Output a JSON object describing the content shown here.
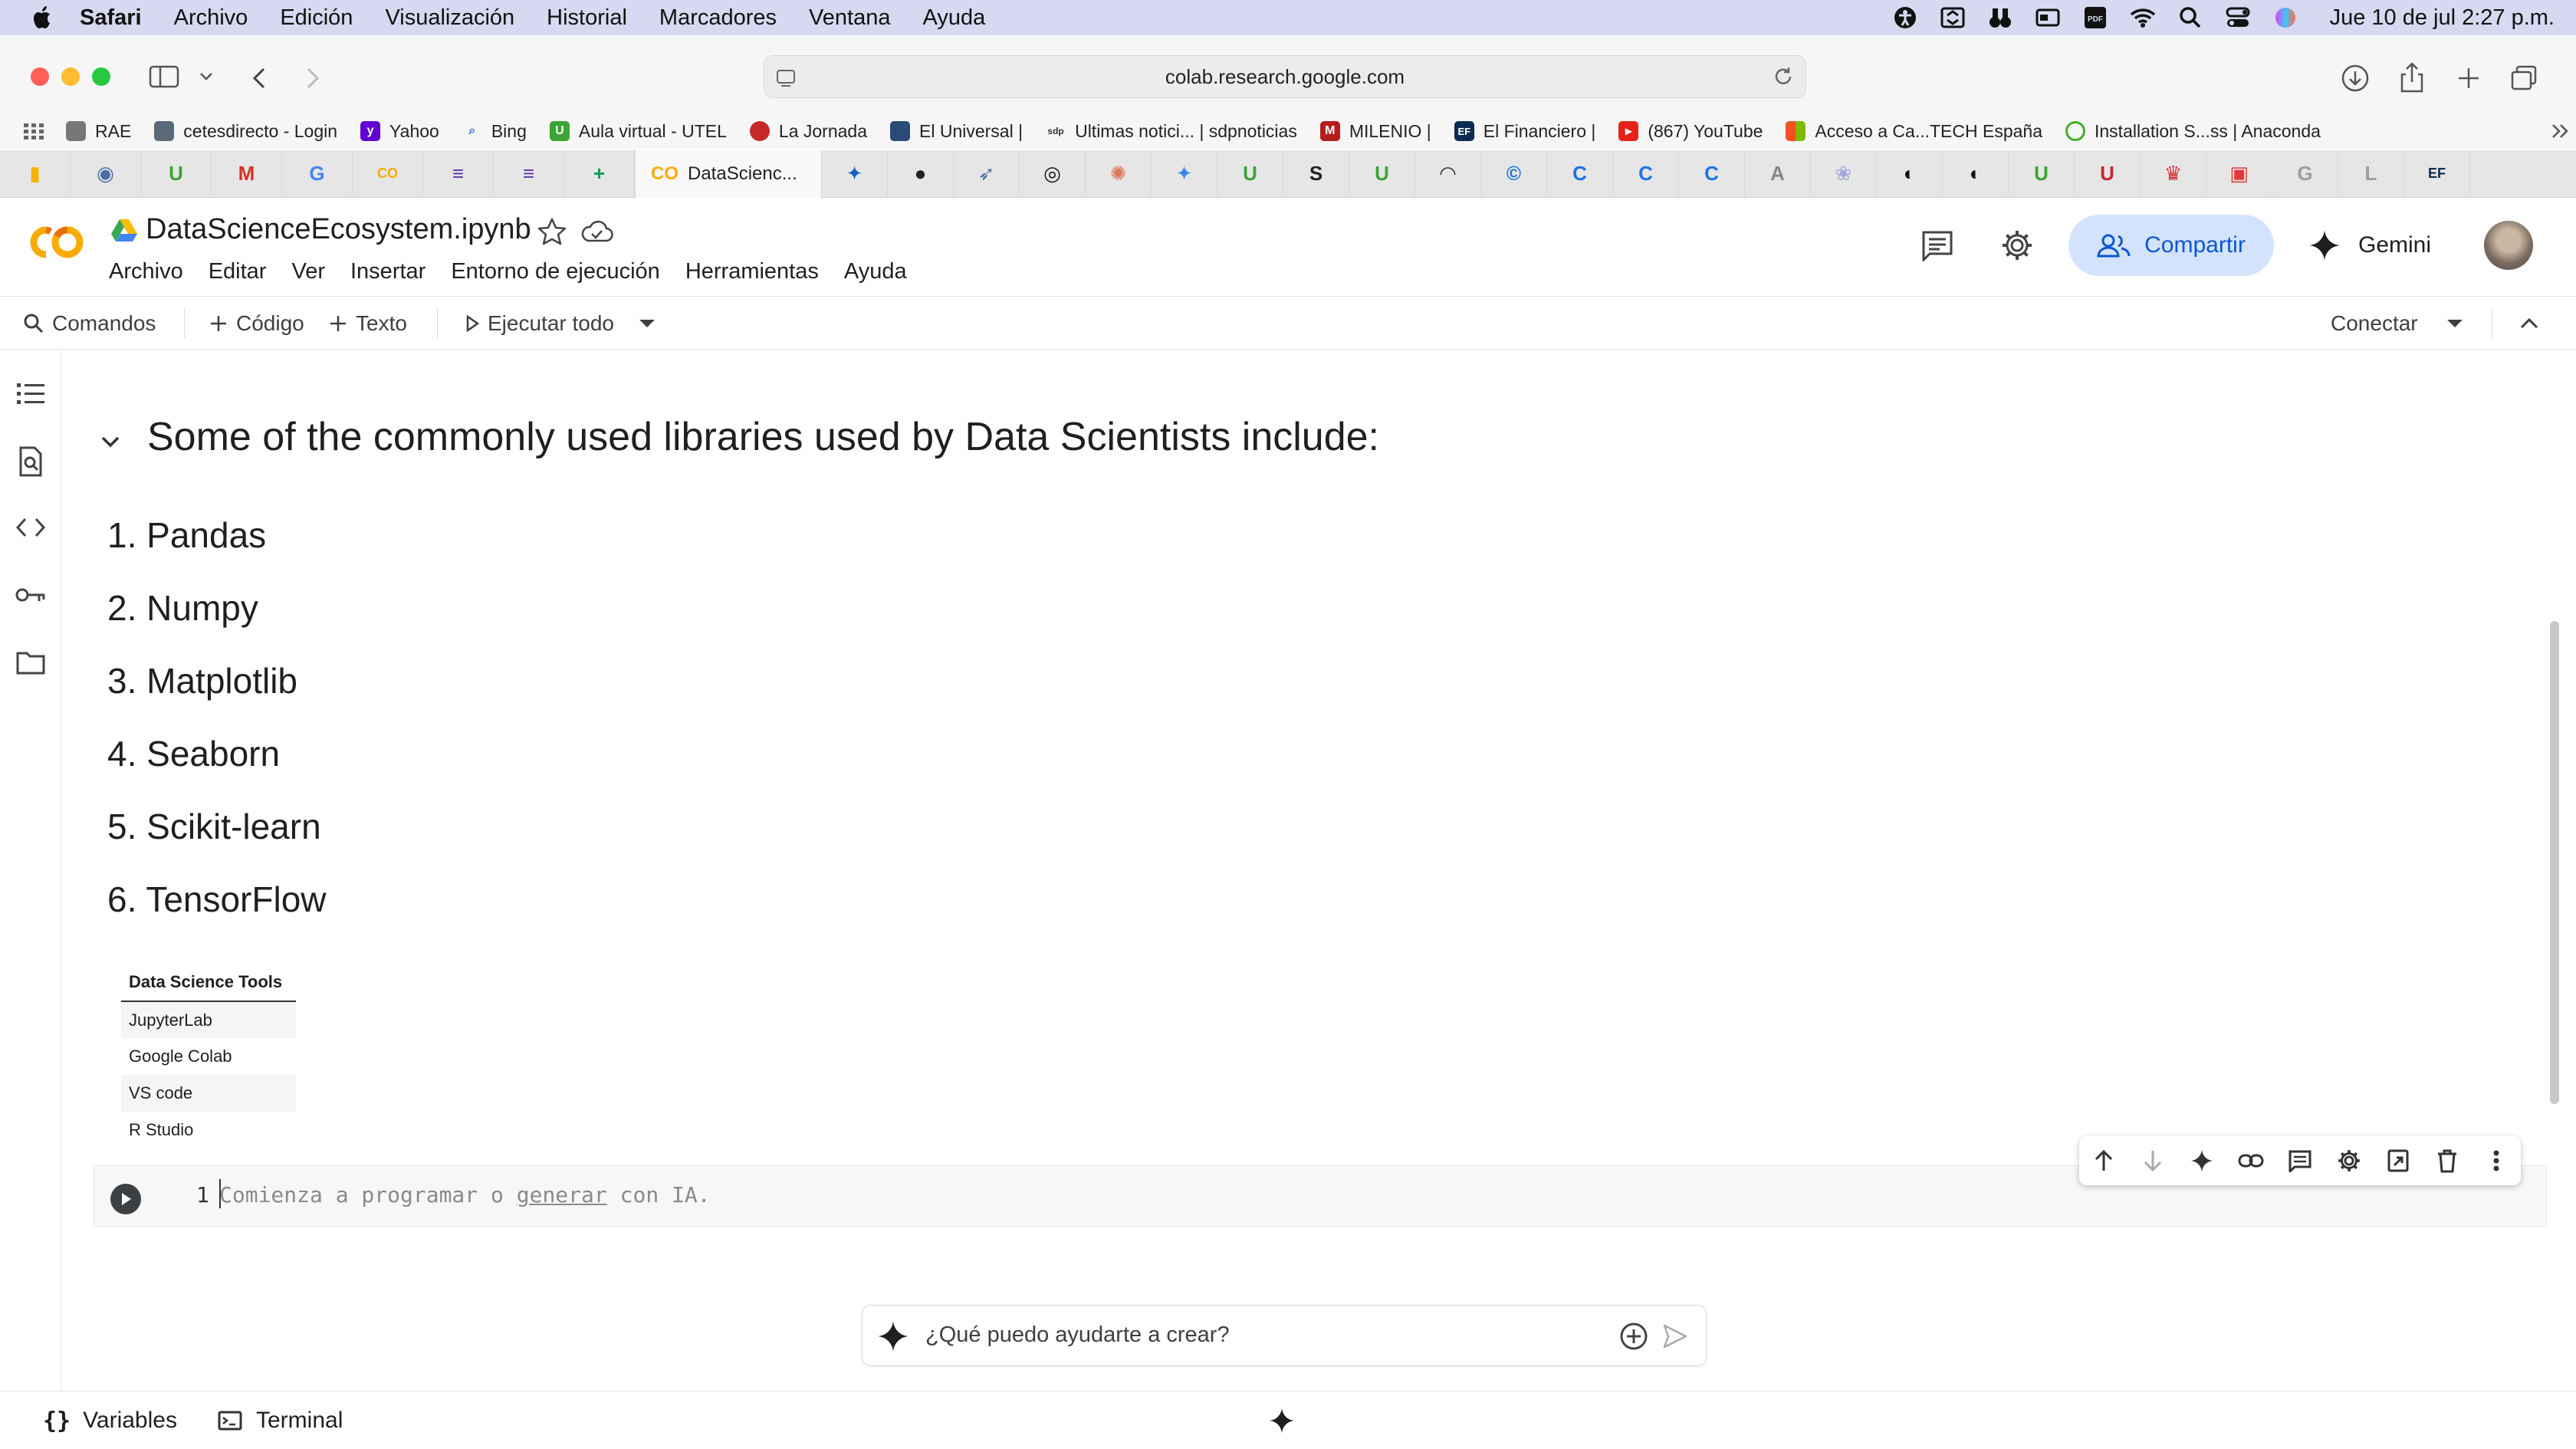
{
  "macos_menubar": {
    "app": "Safari",
    "items": [
      "Archivo",
      "Edición",
      "Visualización",
      "Historial",
      "Marcadores",
      "Ventana",
      "Ayuda"
    ],
    "clock": "Jue 10 de jul   2:27 p.m.",
    "status_icons": [
      "accessibility-icon",
      "sync-icon",
      "binoculars-icon",
      "card-icon",
      "pdf-icon",
      "wifi-icon",
      "search-icon",
      "control-center-icon",
      "siri-icon"
    ]
  },
  "safari": {
    "url": "colab.research.google.com",
    "bookmarks": [
      {
        "label": "RAE",
        "color": "#777"
      },
      {
        "label": "cetesdirecto - Login",
        "color": "#5a6a7a"
      },
      {
        "label": "Yahoo",
        "color": "#6001d2"
      },
      {
        "label": "Bing",
        "color": "#2a6fdb"
      },
      {
        "label": "Aula virtual - UTEL",
        "color": "#3aa534"
      },
      {
        "label": "La Jornada",
        "color": "#c62828"
      },
      {
        "label": "El Universal |",
        "color": "#2b4a7a"
      },
      {
        "label": "Ultimas notici... | sdpnoticias",
        "color": "#333"
      },
      {
        "label": "MILENIO |",
        "color": "#b71c1c"
      },
      {
        "label": "El Financiero |",
        "color": "#0d2a52"
      },
      {
        "label": "(867) YouTube",
        "color": "#e62117"
      },
      {
        "label": "Acceso a Ca...TECH España",
        "color": "#f25022"
      },
      {
        "label": "Installation S...ss | Anaconda",
        "color": "#43b02a"
      }
    ],
    "active_tab": {
      "label": "DataScienc...",
      "favicon": "CO"
    },
    "tab_favicons": [
      {
        "glyph": "▮",
        "color": "#f4b400"
      },
      {
        "glyph": "◉",
        "color": "#4a6fa5"
      },
      {
        "glyph": "U",
        "color": "#3aa534"
      },
      {
        "glyph": "M",
        "color": "#d93025"
      },
      {
        "glyph": "G",
        "color": "#4285f4"
      },
      {
        "glyph": "CO",
        "color": "#f9ab00"
      },
      {
        "glyph": "≡",
        "color": "#5e35b1"
      },
      {
        "glyph": "≡",
        "color": "#5e35b1"
      },
      {
        "glyph": "+",
        "color": "#0f9d58"
      }
    ],
    "tab_favicons_right": [
      {
        "glyph": "✦",
        "color": "#1565c0"
      },
      {
        "glyph": "●",
        "color": "#222"
      },
      {
        "glyph": "➶",
        "color": "#4a6fa5"
      },
      {
        "glyph": "◎",
        "color": "#111"
      },
      {
        "glyph": "✺",
        "color": "#d97757"
      },
      {
        "glyph": "✦",
        "color": "#4285f4"
      },
      {
        "glyph": "U",
        "color": "#3aa534"
      },
      {
        "glyph": "S",
        "color": "#222"
      },
      {
        "glyph": "U",
        "color": "#3aa534"
      },
      {
        "glyph": "◠",
        "color": "#333"
      },
      {
        "glyph": "©",
        "color": "#1976d2"
      },
      {
        "glyph": "C",
        "color": "#1a73e8"
      },
      {
        "glyph": "C",
        "color": "#1a73e8"
      },
      {
        "glyph": "C",
        "color": "#1a73e8"
      },
      {
        "glyph": "A",
        "color": "#888"
      },
      {
        "glyph": "❀",
        "color": "#9fa8da"
      },
      {
        "glyph": "◐",
        "color": "#111"
      },
      {
        "glyph": "◐",
        "color": "#111"
      },
      {
        "glyph": "U",
        "color": "#3aa534"
      },
      {
        "glyph": "U",
        "color": "#c62828"
      },
      {
        "glyph": "♛",
        "color": "#d32f2f"
      },
      {
        "glyph": "▣",
        "color": "#e53935"
      },
      {
        "glyph": "G",
        "color": "#9e9e9e"
      },
      {
        "glyph": "L",
        "color": "#9e9e9e"
      },
      {
        "glyph": "EF",
        "color": "#0d2a52"
      }
    ]
  },
  "colab": {
    "notebook_title": "DataScienceEcosystem.ipynb",
    "menu": [
      "Archivo",
      "Editar",
      "Ver",
      "Insertar",
      "Entorno de ejecución",
      "Herramientas",
      "Ayuda"
    ],
    "share_label": "Compartir",
    "gemini_label": "Gemini",
    "toolbar": {
      "commands": "Comandos",
      "code": "Código",
      "text": "Texto",
      "run_all": "Ejecutar todo",
      "connect": "Conectar"
    }
  },
  "notebook": {
    "heading": "Some of the commonly used libraries used by Data Scientists include:",
    "libraries": [
      "1. Pandas",
      "2. Numpy",
      "3. Matplotlib",
      "4. Seaborn",
      "5. Scikit-learn",
      "6. TensorFlow"
    ],
    "table": {
      "header": "Data Science Tools",
      "rows": [
        "JupyterLab",
        "Google Colab",
        "VS code",
        "R Studio"
      ]
    },
    "code_cell": {
      "line_number": "1",
      "placeholder_before": "Comienza a programar o ",
      "placeholder_link": "generar",
      "placeholder_after": " con IA."
    }
  },
  "prompt": {
    "placeholder": "¿Qué puedo ayudarte a crear?"
  },
  "statusbar": {
    "variables": "Variables",
    "terminal": "Terminal"
  }
}
